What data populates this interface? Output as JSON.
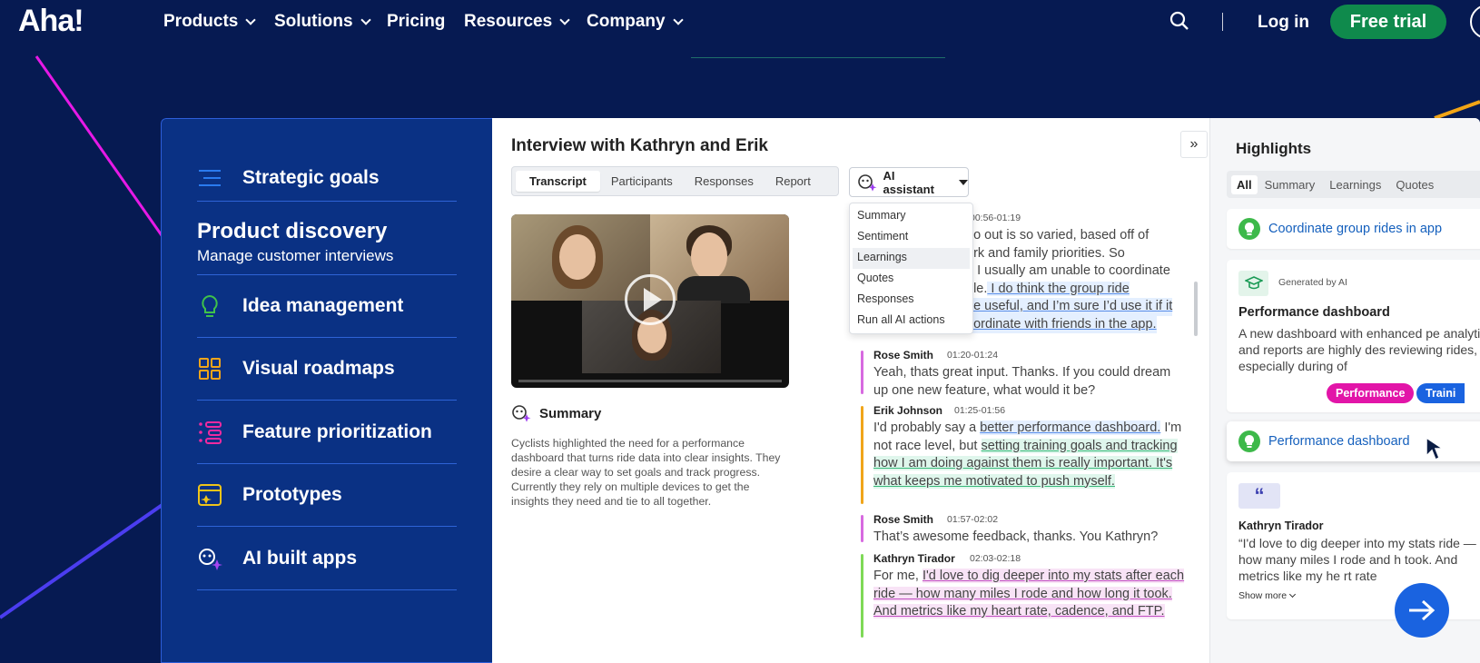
{
  "nav": {
    "logo": "Aha!",
    "items": [
      {
        "label": "Products"
      },
      {
        "label": "Solutions"
      },
      {
        "label": "Pricing"
      },
      {
        "label": "Resources"
      },
      {
        "label": "Company"
      }
    ],
    "login": "Log in",
    "trial": "Free trial"
  },
  "sidebar": {
    "items": [
      {
        "label": "Strategic goals",
        "icon": "menu-lines-icon"
      },
      {
        "label": "Product discovery",
        "sub": "Manage customer interviews"
      },
      {
        "label": "Idea management",
        "icon": "lightbulb-icon"
      },
      {
        "label": "Visual roadmaps",
        "icon": "grid-icon"
      },
      {
        "label": "Feature prioritization",
        "icon": "priority-list-icon"
      },
      {
        "label": "Prototypes",
        "icon": "prototype-icon"
      },
      {
        "label": "AI built apps",
        "icon": "ai-sparkle-icon"
      }
    ]
  },
  "interview": {
    "title": "Interview with Kathryn and Erik",
    "tabs": [
      "Transcript",
      "Participants",
      "Responses",
      "Report"
    ],
    "ai_button": "AI assistant",
    "dropdown": [
      "Summary",
      "Sentiment",
      "Learnings",
      "Quotes",
      "Responses",
      "Run all AI actions"
    ],
    "summary_title": "Summary",
    "summary_text": "Cyclists highlighted the need for a performance dashboard that turns ride data into clear insights. They desire a clear way to set goals and track progress. Currently they rely on multiple devices to get the insights they need and tie to all together."
  },
  "transcript": {
    "first_time": "00:56-01:19",
    "first_lines": [
      "go out is so varied, based off of",
      "ork and family priorities. So",
      "t, I usually am unable to coordinate",
      "ple.",
      " I do think the group ride",
      "be useful, and I’m sure I’d use it if it",
      "oordinate with friends in the app."
    ],
    "entries": [
      {
        "name": "Rose Smith",
        "time": "01:20-01:24",
        "text": "Yeah, thats great input. Thanks. If you could dream up one new feature, what would it be?"
      },
      {
        "name": "Erik Johnson",
        "time": "01:25-01:56",
        "t1": "I'd probably say a ",
        "h1": "better performance dashboard.",
        "t2": " I'm not race level, but ",
        "h2": "setting training goals and tracking how I am doing against them is really important. It's what keeps me motivated to push myself."
      },
      {
        "name": "Rose Smith",
        "time": "01:57-02:02",
        "text": "That’s awesome feedback, thanks. You Kathryn?"
      },
      {
        "name": "Kathryn Tirador",
        "time": "02:03-02:18",
        "t1": "For me, ",
        "h1": "I'd love to dig deeper into my stats after each ride — how many miles I rode and how long it took. And metrics like my heart rate, cadence, and FTP."
      }
    ]
  },
  "highlights": {
    "title": "Highlights",
    "tabs": [
      "All",
      "Summary",
      "Learnings",
      "Quotes"
    ],
    "idea1": "Coordinate group rides in app",
    "generated": "Generated by AI",
    "card_title": "Performance dashboard",
    "card_text": "A new dashboard with enhanced pe analytics and reports are highly des reviewing rides, especially during of",
    "tags": [
      "Performance",
      "Traini"
    ],
    "idea2": "Performance dashboard",
    "quote_name": "Kathryn Tirador",
    "quote_text": "“I'd love to dig deeper into my stats ride — how many miles I rode and h took. And metrics like my he  rt rate",
    "show_more": "Show more"
  }
}
